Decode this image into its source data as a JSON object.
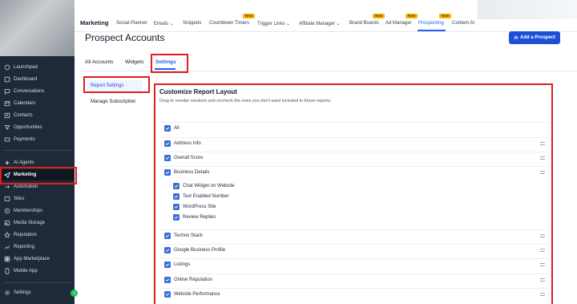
{
  "sidebar": {
    "items": [
      {
        "label": "Launchpad",
        "icon": "launchpad-icon"
      },
      {
        "label": "Dashboard",
        "icon": "dashboard-icon"
      },
      {
        "label": "Conversations",
        "icon": "chat-icon"
      },
      {
        "label": "Calendars",
        "icon": "calendar-icon"
      },
      {
        "label": "Contacts",
        "icon": "contacts-icon"
      },
      {
        "label": "Opportunities",
        "icon": "funnel-icon"
      },
      {
        "label": "Payments",
        "icon": "payments-icon"
      },
      {
        "label": "AI Agents",
        "icon": "ai-agents-icon"
      },
      {
        "label": "Marketing",
        "icon": "send-icon"
      },
      {
        "label": "Automation",
        "icon": "automation-icon"
      },
      {
        "label": "Sites",
        "icon": "sites-icon"
      },
      {
        "label": "Memberships",
        "icon": "memberships-icon"
      },
      {
        "label": "Media Storage",
        "icon": "media-icon"
      },
      {
        "label": "Reputation",
        "icon": "star-icon"
      },
      {
        "label": "Reporting",
        "icon": "reporting-icon"
      },
      {
        "label": "App Marketplace",
        "icon": "marketplace-icon"
      },
      {
        "label": "Mobile App",
        "icon": "mobile-icon"
      }
    ],
    "settings_label": "Settings"
  },
  "topnav": {
    "title": "Marketing",
    "items": [
      "Social Planner",
      "Emails",
      "Snippets",
      "Countdown Timers",
      "Trigger Links",
      "Affiliate Manager",
      "Brand Boards",
      "Ad Manager",
      "Prospecting",
      "Content AI"
    ],
    "new_badge": "New",
    "active": "Prospecting"
  },
  "page": {
    "title": "Prospect Accounts",
    "add_button": "Add a Prospect",
    "tabs": [
      "All Accounts",
      "Widgets",
      "Settings"
    ],
    "active_tab": "Settings"
  },
  "settings_menu": [
    "Report Settings",
    "Manage Subscription"
  ],
  "panel": {
    "title": "Customize Report Layout",
    "description": "Drag to reorder sections and uncheck the ones you don't want included in future reports.",
    "sections": [
      {
        "label": "All",
        "checked": true
      },
      {
        "label": "Address Info",
        "checked": true
      },
      {
        "label": "Overall Score",
        "checked": true
      },
      {
        "label": "Business Details",
        "checked": true
      },
      {
        "label": "Chat Widget on Website",
        "checked": true
      },
      {
        "label": "Text Enabled Number",
        "checked": true
      },
      {
        "label": "WordPress Site",
        "checked": true
      },
      {
        "label": "Review Replies",
        "checked": true
      },
      {
        "label": "Techno Stack",
        "checked": true
      },
      {
        "label": "Google Business Profile",
        "checked": true
      },
      {
        "label": "Listings",
        "checked": true
      },
      {
        "label": "Online Reputation",
        "checked": true
      },
      {
        "label": "Website Performance",
        "checked": true
      }
    ]
  },
  "colors": {
    "accent": "#2563eb",
    "highlight": "#e11d1d",
    "sidebar": "#1e2a38",
    "new_badge": "#f5b301"
  }
}
